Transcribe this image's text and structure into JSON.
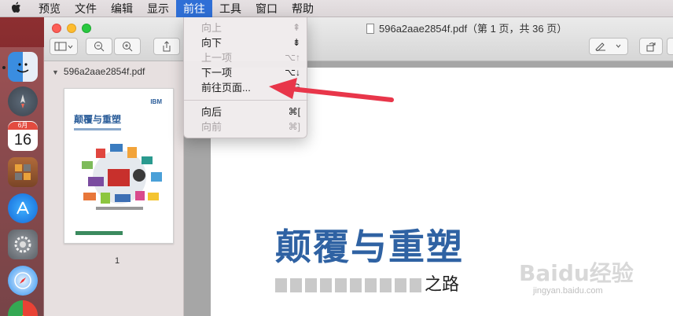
{
  "menubar": {
    "items": [
      {
        "label": "预览"
      },
      {
        "label": "文件"
      },
      {
        "label": "编辑"
      },
      {
        "label": "显示"
      },
      {
        "label": "前往",
        "active": true
      },
      {
        "label": "工具"
      },
      {
        "label": "窗口"
      },
      {
        "label": "帮助"
      }
    ]
  },
  "go_menu": {
    "items": [
      {
        "label": "向上",
        "shortcut": "⇞",
        "enabled": false
      },
      {
        "label": "向下",
        "shortcut": "⇟",
        "enabled": true
      },
      {
        "label": "上一项",
        "shortcut": "⌥↑",
        "enabled": false
      },
      {
        "label": "下一项",
        "shortcut": "⌥↓",
        "enabled": true
      },
      {
        "label": "前往页面...",
        "shortcut": "⌥⌘G",
        "enabled": true
      },
      {
        "label": "向后",
        "shortcut": "⌘[",
        "enabled": true
      },
      {
        "label": "向前",
        "shortcut": "⌘]",
        "enabled": false
      }
    ]
  },
  "window": {
    "title": "596a2aae2854f.pdf（第 1 页，共 36 页）",
    "sidebar_file": "596a2aae2854f.pdf",
    "thumb_page_number": "1"
  },
  "dock": {
    "calendar_month": "6月",
    "calendar_day": "16"
  },
  "page": {
    "title": "颠覆与重塑",
    "subtitle_visible": "之路"
  },
  "thumbnail": {
    "title": "颠覆与重塑",
    "logo": "IBM"
  },
  "watermark": {
    "text": "Baidu经验",
    "url": "jingyan.baidu.com"
  },
  "colors": {
    "menu_highlight": "#2f6fd6",
    "title_blue": "#2f62a3",
    "arrow_red": "#e8364a"
  }
}
